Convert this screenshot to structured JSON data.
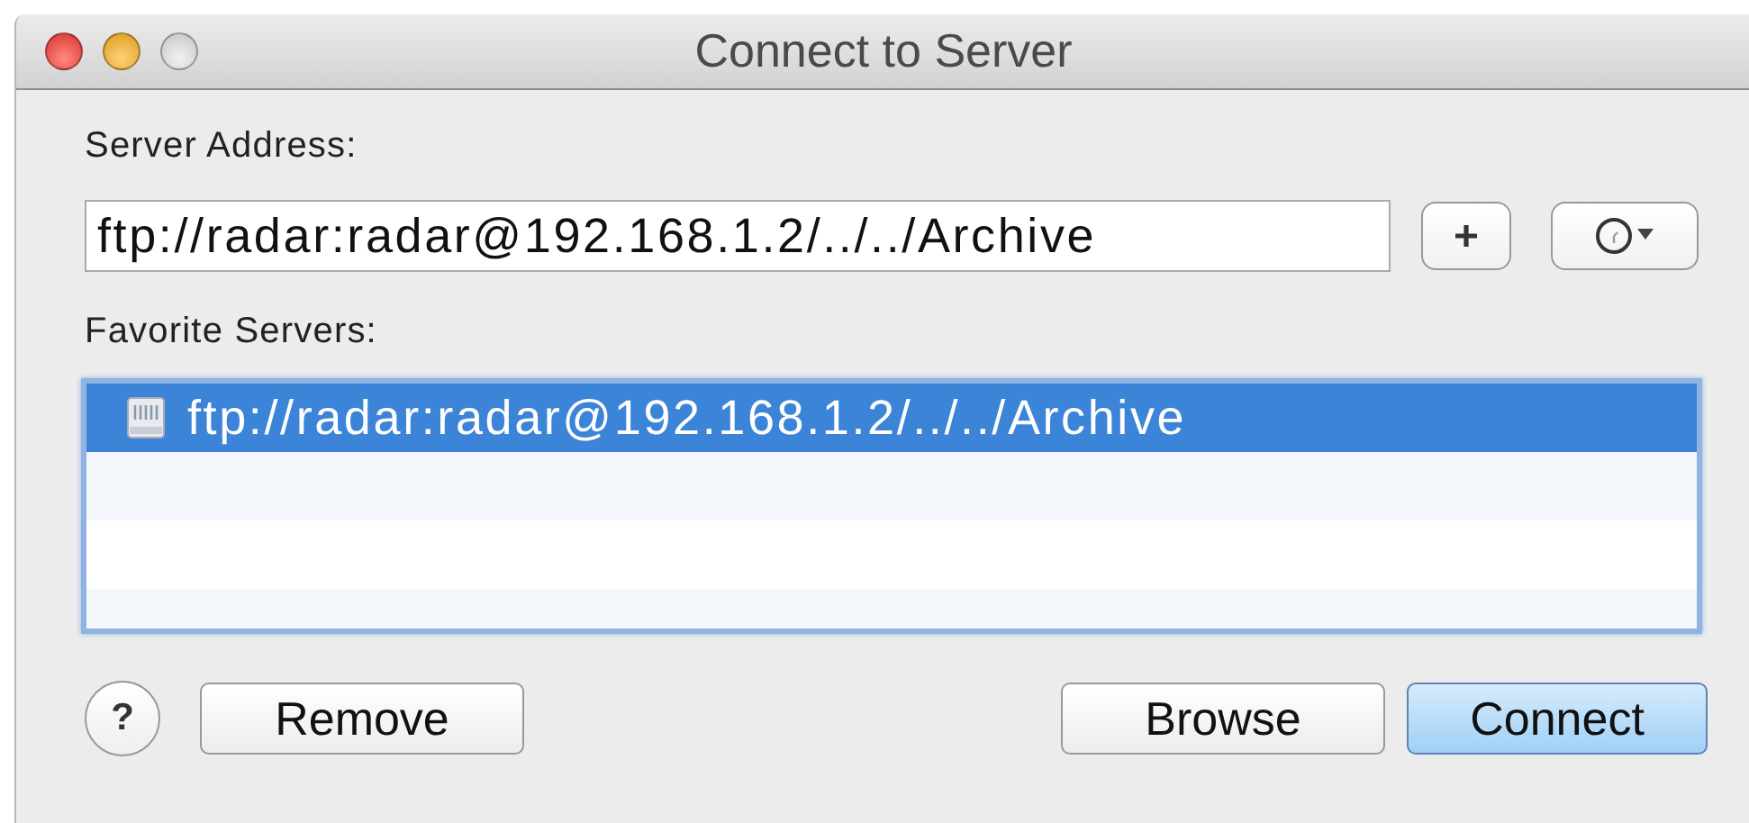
{
  "window": {
    "title": "Connect to Server",
    "controls": [
      {
        "kind": "close",
        "disabled": false
      },
      {
        "kind": "minimize",
        "disabled": false
      },
      {
        "kind": "zoom",
        "disabled": true
      }
    ]
  },
  "server_address": {
    "label": "Server Address:",
    "value": "ftp://radar:radar@192.168.1.2/../../Archive"
  },
  "favorite_servers": {
    "label": "Favorite Servers:",
    "items": [
      {
        "label": "ftp://radar:radar@192.168.1.2/../../Archive",
        "selected": true
      }
    ]
  },
  "help_button": {
    "label": "?"
  },
  "buttons": [
    {
      "label": "Remove",
      "kind": "left",
      "default": false
    },
    {
      "label": "Browse",
      "kind": "right",
      "default": false
    },
    {
      "label": "Connect",
      "kind": "right",
      "default": true
    }
  ]
}
